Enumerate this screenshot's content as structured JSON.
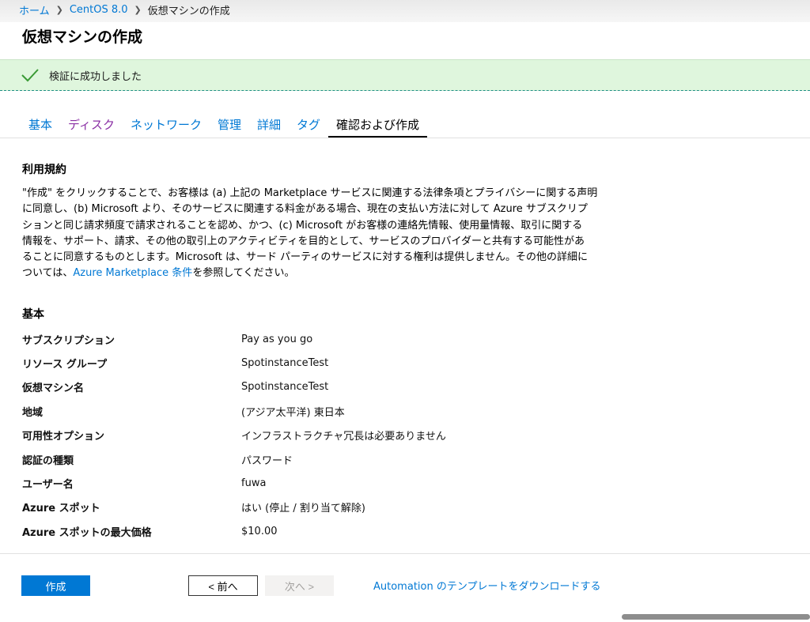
{
  "breadcrumb": {
    "home": "ホーム",
    "item1": "CentOS 8.0",
    "current": "仮想マシンの作成"
  },
  "page": {
    "title": "仮想マシンの作成"
  },
  "validation": {
    "message": "検証に成功しました",
    "icon": "checkmark-icon",
    "color": "#3a9a35"
  },
  "tabs": [
    {
      "label": "基本"
    },
    {
      "label": "ディスク"
    },
    {
      "label": "ネットワーク"
    },
    {
      "label": "管理"
    },
    {
      "label": "詳細"
    },
    {
      "label": "タグ"
    },
    {
      "label": "確認および作成"
    }
  ],
  "terms": {
    "heading": "利用規約",
    "lines": [
      "\"作成\" をクリックすることで、お客様は (a) 上記の Marketplace サービスに関連する法律条項とプライバシーに関する声明",
      "に同意し、(b) Microsoft より、そのサービスに関連する料金がある場合、現在の支払い方法に対して Azure サブスクリプ",
      "ションと同じ請求頻度で請求されることを認め、かつ、(c) Microsoft がお客様の連絡先情報、使用量情報、取引に関する",
      "情報を、サポート、請求、その他の取引上のアクティビティを目的として、サービスのプロバイダーと共有する可能性があ",
      "ることに同意するものとします。Microsoft は、サード パーティのサービスに対する権利は提供しません。その他の詳細に"
    ],
    "last_prefix": "ついては、",
    "link_text": "Azure Marketplace 条件",
    "last_suffix": "を参照してください。"
  },
  "basics": {
    "heading": "基本",
    "rows": [
      {
        "key": "サブスクリプション",
        "value": "Pay as you go"
      },
      {
        "key": "リソース グループ",
        "value": "SpotinstanceTest"
      },
      {
        "key": "仮想マシン名",
        "value": "SpotinstanceTest"
      },
      {
        "key": "地域",
        "value": "(アジア太平洋) 東日本"
      },
      {
        "key": "可用性オプション",
        "value": "インフラストラクチャ冗長は必要ありません"
      },
      {
        "key": "認証の種類",
        "value": "パスワード"
      },
      {
        "key": "ユーザー名",
        "value": "fuwa"
      },
      {
        "key": "Azure スポット",
        "value": "はい (停止 / 割り当て解除)"
      },
      {
        "key": "Azure スポットの最大価格",
        "value": "$10.00"
      }
    ]
  },
  "footer": {
    "create_label": "作成",
    "prev_label": "< 前へ",
    "next_label": "次へ >",
    "automation_link": "Automation のテンプレートをダウンロードする"
  },
  "colors": {
    "accent": "#0078d4",
    "success_bg": "#dff6dd",
    "visited_tab": "#8a2fa4"
  }
}
